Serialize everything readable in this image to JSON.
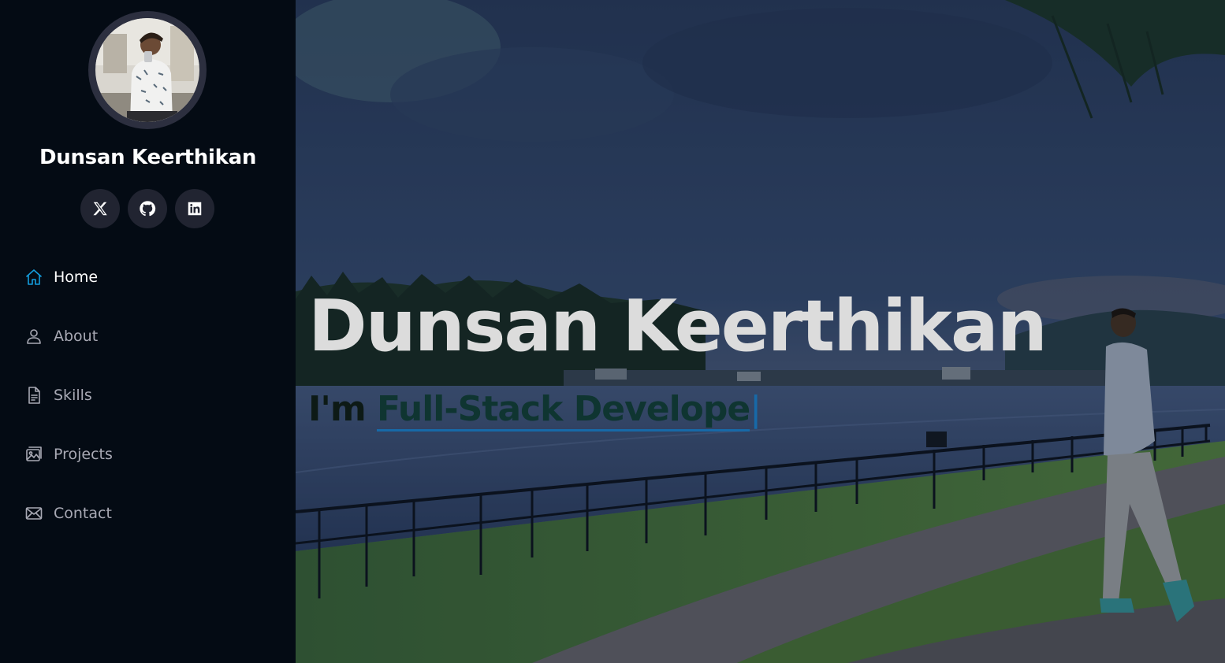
{
  "profile": {
    "name": "Dunsan Keerthikan",
    "avatar_alt": "avatar-photo"
  },
  "social": [
    {
      "icon": "x-twitter-icon",
      "label": "X"
    },
    {
      "icon": "github-icon",
      "label": "GitHub"
    },
    {
      "icon": "linkedin-icon",
      "label": "LinkedIn"
    }
  ],
  "nav": {
    "items": [
      {
        "label": "Home",
        "icon": "home-icon",
        "active": true
      },
      {
        "label": "About",
        "icon": "person-icon",
        "active": false
      },
      {
        "label": "Skills",
        "icon": "file-icon",
        "active": false
      },
      {
        "label": "Projects",
        "icon": "images-icon",
        "active": false
      },
      {
        "label": "Contact",
        "icon": "envelope-icon",
        "active": false
      }
    ]
  },
  "hero": {
    "title": "Dunsan Keerthikan",
    "subtitle_prefix": "I'm ",
    "typed_text": "Full-Stack Develope",
    "cursor": "|"
  },
  "colors": {
    "sidebar_bg": "#040b14",
    "accent": "#149ddd",
    "nav_text": "#a8a9b4",
    "social_bg": "#212431"
  }
}
